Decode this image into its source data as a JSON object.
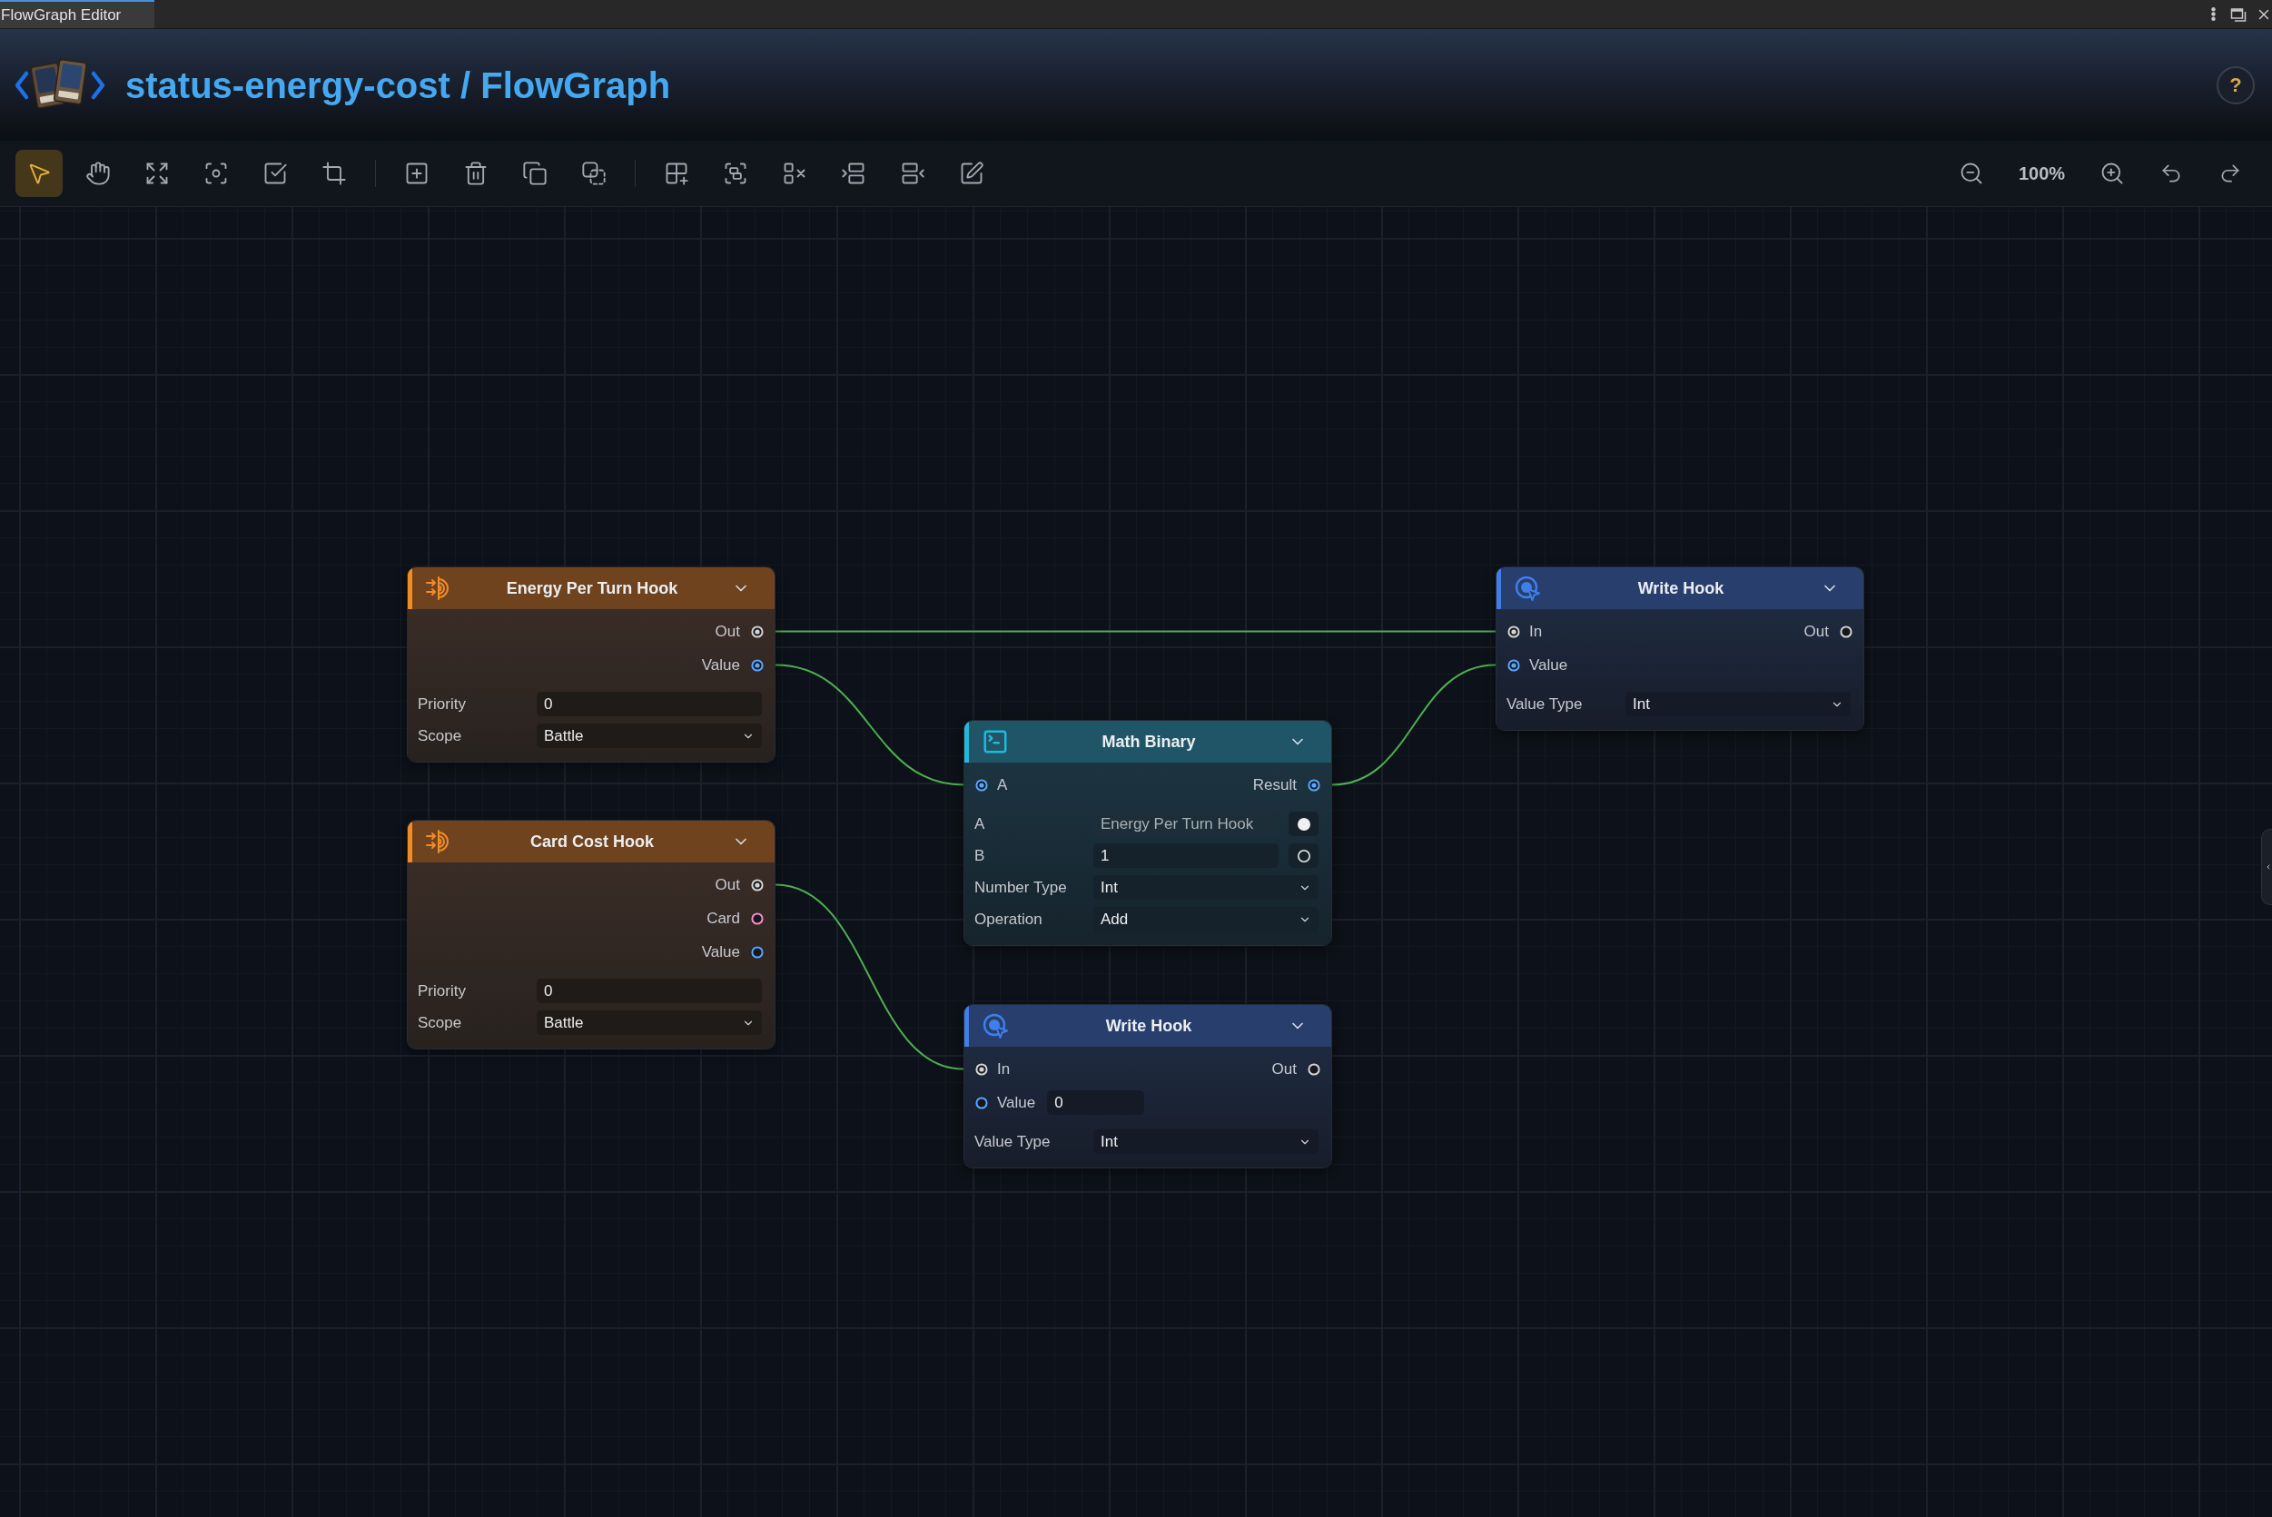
{
  "window": {
    "tab": "FlowGraph Editor"
  },
  "header": {
    "title": "status-energy-cost / FlowGraph",
    "help": "?"
  },
  "toolbar": {
    "groups": [
      [
        {
          "kind": "select",
          "selected": true
        },
        {
          "kind": "pan",
          "selected": false
        },
        {
          "kind": "fit",
          "selected": false
        },
        {
          "kind": "focus",
          "selected": false
        },
        {
          "kind": "select_all",
          "selected": false
        },
        {
          "kind": "crop",
          "selected": false
        }
      ],
      [
        {
          "kind": "add",
          "selected": false
        },
        {
          "kind": "delete",
          "selected": false
        },
        {
          "kind": "duplicate",
          "selected": false
        },
        {
          "kind": "paste",
          "selected": false
        }
      ],
      [
        {
          "kind": "add_group",
          "selected": false
        },
        {
          "kind": "group",
          "selected": false
        },
        {
          "kind": "ungroup",
          "selected": false
        },
        {
          "kind": "align_left",
          "selected": false
        },
        {
          "kind": "align_right",
          "selected": false
        },
        {
          "kind": "edit",
          "selected": false
        }
      ]
    ],
    "zoom": "100%"
  },
  "nodes": [
    {
      "kind": "event",
      "title": "Energy Per Turn Hook",
      "expanded": true,
      "outputs": [
        {
          "label": "Out",
          "color": "#d4d4d4",
          "connected": true
        },
        {
          "label": "Value",
          "color": "#58a6ff",
          "connected": true
        }
      ],
      "fields": [
        {
          "kind": "input",
          "label": "Priority",
          "value": "0"
        },
        {
          "kind": "select",
          "label": "Scope",
          "value": "Battle"
        }
      ]
    },
    {
      "kind": "write",
      "title": "Write Hook",
      "expanded": true,
      "inputs": [
        {
          "label": "In",
          "color": "#d4d4d4",
          "connected": true
        },
        {
          "label": "Value",
          "color": "#58a6ff",
          "connected": true
        }
      ],
      "outputs": [
        {
          "label": "Out",
          "color": "#d4d4d4",
          "connected": false
        }
      ],
      "fields": [
        {
          "kind": "select",
          "label": "Value Type",
          "value": "Int"
        }
      ]
    },
    {
      "kind": "math",
      "title": "Math Binary",
      "expanded": true,
      "inputs": [
        {
          "label": "A",
          "color": "#58a6ff",
          "connected": true
        }
      ],
      "outputs": [
        {
          "label": "Result",
          "color": "#58a6ff",
          "connected": true
        }
      ],
      "fields": [
        {
          "kind": "input_toggle",
          "label": "A",
          "value": "Energy Per Turn Hook",
          "linked": true
        },
        {
          "kind": "input_toggle",
          "label": "B",
          "value": "1",
          "linked": false
        },
        {
          "kind": "select",
          "label": "Number Type",
          "value": "Int"
        },
        {
          "kind": "select",
          "label": "Operation",
          "value": "Add"
        }
      ]
    },
    {
      "kind": "event",
      "title": "Card Cost Hook",
      "expanded": true,
      "outputs": [
        {
          "label": "Out",
          "color": "#d4d4d4",
          "connected": true
        },
        {
          "label": "Card",
          "color": "#f48fc8",
          "connected": false
        },
        {
          "label": "Value",
          "color": "#58a6ff",
          "connected": false
        }
      ],
      "fields": [
        {
          "kind": "input",
          "label": "Priority",
          "value": "0"
        },
        {
          "kind": "select",
          "label": "Scope",
          "value": "Battle"
        }
      ]
    },
    {
      "kind": "write",
      "title": "Write Hook",
      "expanded": true,
      "inputs": [
        {
          "label": "In",
          "color": "#d4d4d4",
          "connected": true
        },
        {
          "label": "Value",
          "color": "#58a6ff",
          "connected": false,
          "value": "0"
        }
      ],
      "outputs": [
        {
          "label": "Out",
          "color": "#d4d4d4",
          "connected": false
        }
      ],
      "fields": [
        {
          "kind": "select",
          "label": "Value Type",
          "value": "Int"
        }
      ]
    }
  ]
}
